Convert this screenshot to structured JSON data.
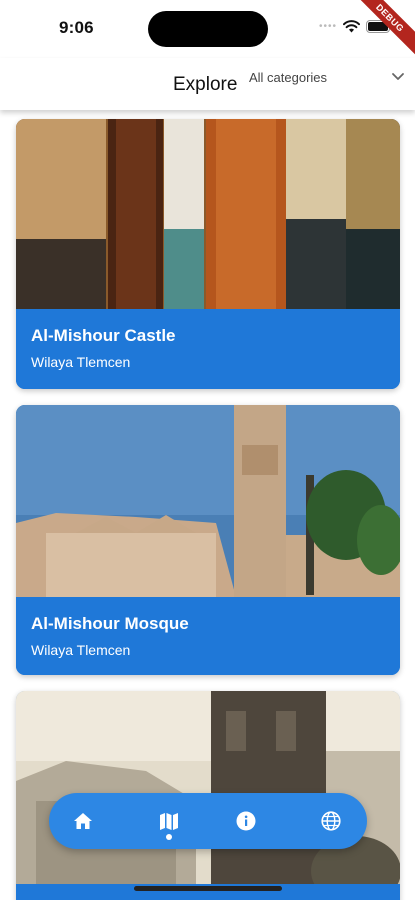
{
  "status_bar": {
    "time": "9:06",
    "dots": "••••",
    "debug_banner": "DEBUG"
  },
  "app_bar": {
    "title": "Explore",
    "category_select": {
      "selected": "All categories"
    }
  },
  "places": [
    {
      "name": "Al-Mishour Castle",
      "location": "Wilaya Tlemcen"
    },
    {
      "name": "Al-Mishour Mosque",
      "location": "Wilaya Tlemcen"
    }
  ],
  "bottom_nav": {
    "items": [
      {
        "icon": "home-icon",
        "active": false
      },
      {
        "icon": "map-icon",
        "active": true
      },
      {
        "icon": "info-icon",
        "active": false
      },
      {
        "icon": "globe-icon",
        "active": false
      }
    ]
  },
  "colors": {
    "accent": "#1f78d8",
    "nav": "#2d87e4",
    "debug": "#b3261e"
  }
}
